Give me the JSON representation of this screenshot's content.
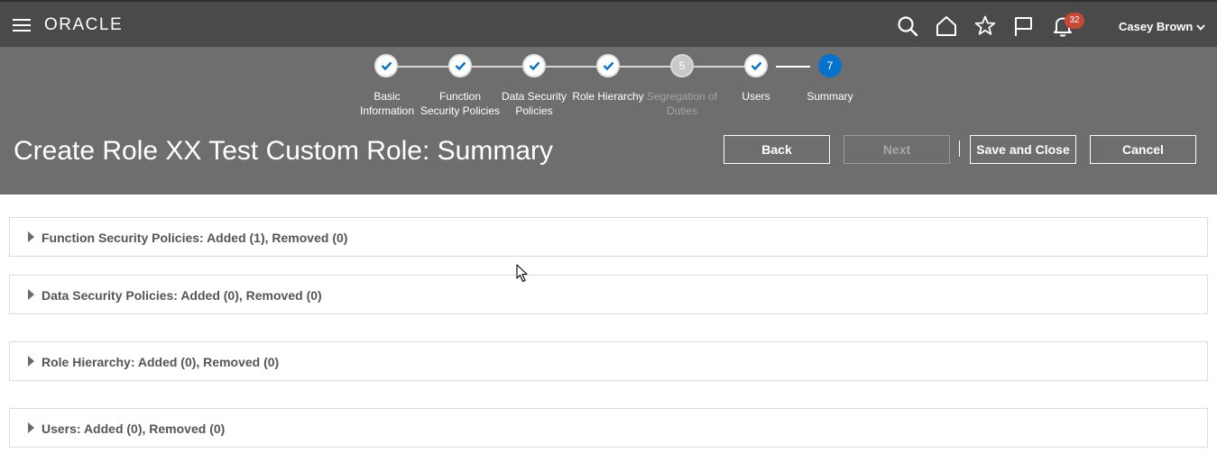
{
  "header": {
    "logo": "ORACLE",
    "notification_count": "32",
    "user_name": "Casey Brown",
    "icons": [
      "menu-icon",
      "search-icon",
      "home-icon",
      "favorites-star-icon",
      "flag-icon",
      "bell-icon",
      "chevron-down-icon"
    ]
  },
  "train": {
    "steps": [
      {
        "label_line1": "Basic",
        "label_line2": "Information",
        "state": "done"
      },
      {
        "label_line1": "Function",
        "label_line2": "Security Policies",
        "state": "done"
      },
      {
        "label_line1": "Data Security",
        "label_line2": "Policies",
        "state": "done"
      },
      {
        "label_line1": "Role Hierarchy",
        "label_line2": "",
        "state": "done"
      },
      {
        "label_line1": "Segregation of",
        "label_line2": "Duties",
        "state": "disabled",
        "number": "5"
      },
      {
        "label_line1": "Users",
        "label_line2": "",
        "state": "done"
      },
      {
        "label_line1": "Summary",
        "label_line2": "",
        "state": "current",
        "number": "7"
      }
    ]
  },
  "page": {
    "title": "Create Role XX Test Custom Role: Summary"
  },
  "buttons": {
    "back": "Back",
    "next": "Next",
    "save_close": "Save and Close",
    "cancel": "Cancel"
  },
  "sections": [
    {
      "title": "Function Security Policies: Added (1), Removed (0)"
    },
    {
      "title": "Data Security Policies: Added (0), Removed (0)"
    },
    {
      "title": "Role Hierarchy: Added (0), Removed (0)"
    },
    {
      "title": "Users: Added (0), Removed (0)"
    }
  ],
  "colors": {
    "header_bg": "#4a4a4a",
    "band_bg": "#6e6e6e",
    "current_step": "#0572ce",
    "badge": "#c74634"
  }
}
